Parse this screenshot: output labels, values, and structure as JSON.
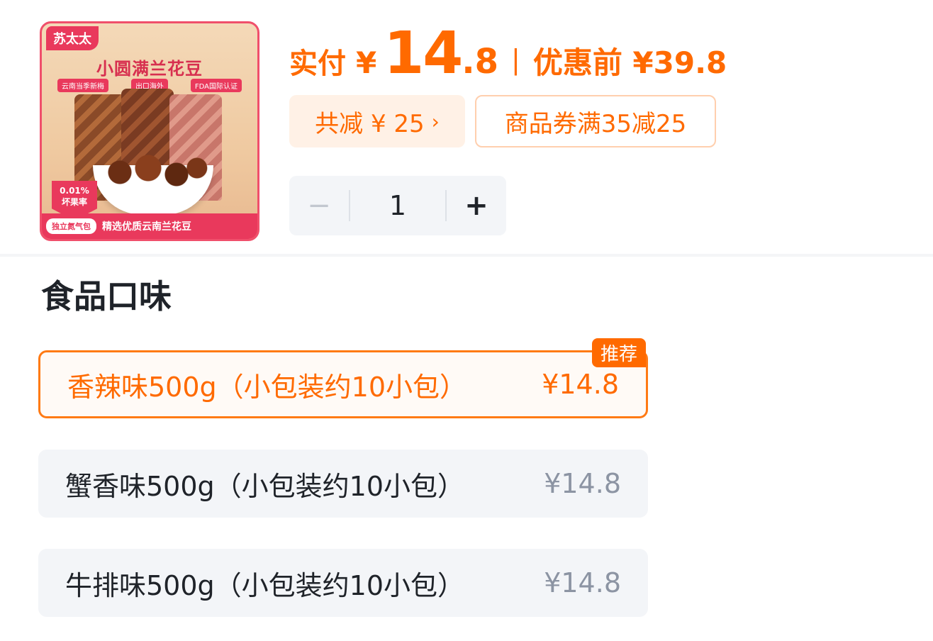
{
  "product": {
    "image_brand": "苏太太",
    "image_title": "小圆满兰花豆",
    "image_tags": [
      "云南当季新梅",
      "出口海外",
      "FDA国际认证"
    ],
    "image_badge_value": "0.01%",
    "image_badge_label": "坏果率",
    "image_bottom_tag": "独立氮气包",
    "image_bottom_text": "精选优质云南兰花豆"
  },
  "price": {
    "label": "实付",
    "currency": "¥",
    "integer": "14",
    "decimal": ".8",
    "separator": "|",
    "before_label": "优惠前 ¥39.8"
  },
  "discount": {
    "total_label": "共减 ¥ 25",
    "chevron": "›",
    "coupon_label": "商品券满35减25"
  },
  "quantity": {
    "minus": "−",
    "value": "1",
    "plus": "+"
  },
  "flavor_section": {
    "title": "食品口味",
    "recommend_badge": "推荐",
    "options": [
      {
        "label": "香辣味500g（小包装约10小包）",
        "price": "¥14.8",
        "selected": true
      },
      {
        "label": "蟹香味500g（小包装约10小包）",
        "price": "¥14.8",
        "selected": false
      },
      {
        "label": "牛排味500g（小包装约10小包）",
        "price": "¥14.8",
        "selected": false
      }
    ]
  },
  "colors": {
    "accent": "#ff6a00",
    "accent_soft": "#fff1e6",
    "option_bg": "#f3f5f8",
    "text": "#1f2329",
    "muted": "#8c94a3"
  }
}
